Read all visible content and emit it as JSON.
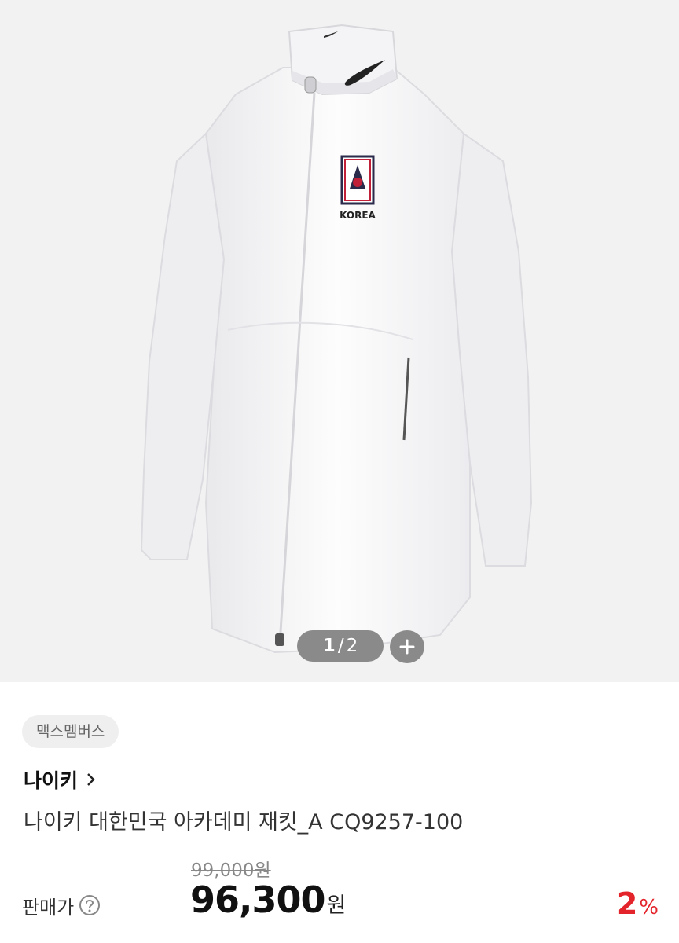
{
  "gallery": {
    "current": "1",
    "total": "2",
    "image_alt": "white jacket with KOREA crest",
    "crest_text": "KOREA"
  },
  "product": {
    "badge": "맥스멤버스",
    "brand": "나이키",
    "title": "나이키 대한민국 아카데미 재킷_A CQ9257-100",
    "original_price": "99,000원",
    "price_label": "판매가",
    "price": "96,300",
    "price_unit": "원",
    "discount": "2",
    "discount_unit": "%"
  },
  "colors": {
    "accent": "#e3242b",
    "overlay": "#8a8a8a",
    "gallery_bg": "#f2f2f2"
  },
  "icons": {
    "zoom": "plus-icon",
    "brand_link": "chevron-right-icon",
    "help": "question-circle-icon"
  }
}
